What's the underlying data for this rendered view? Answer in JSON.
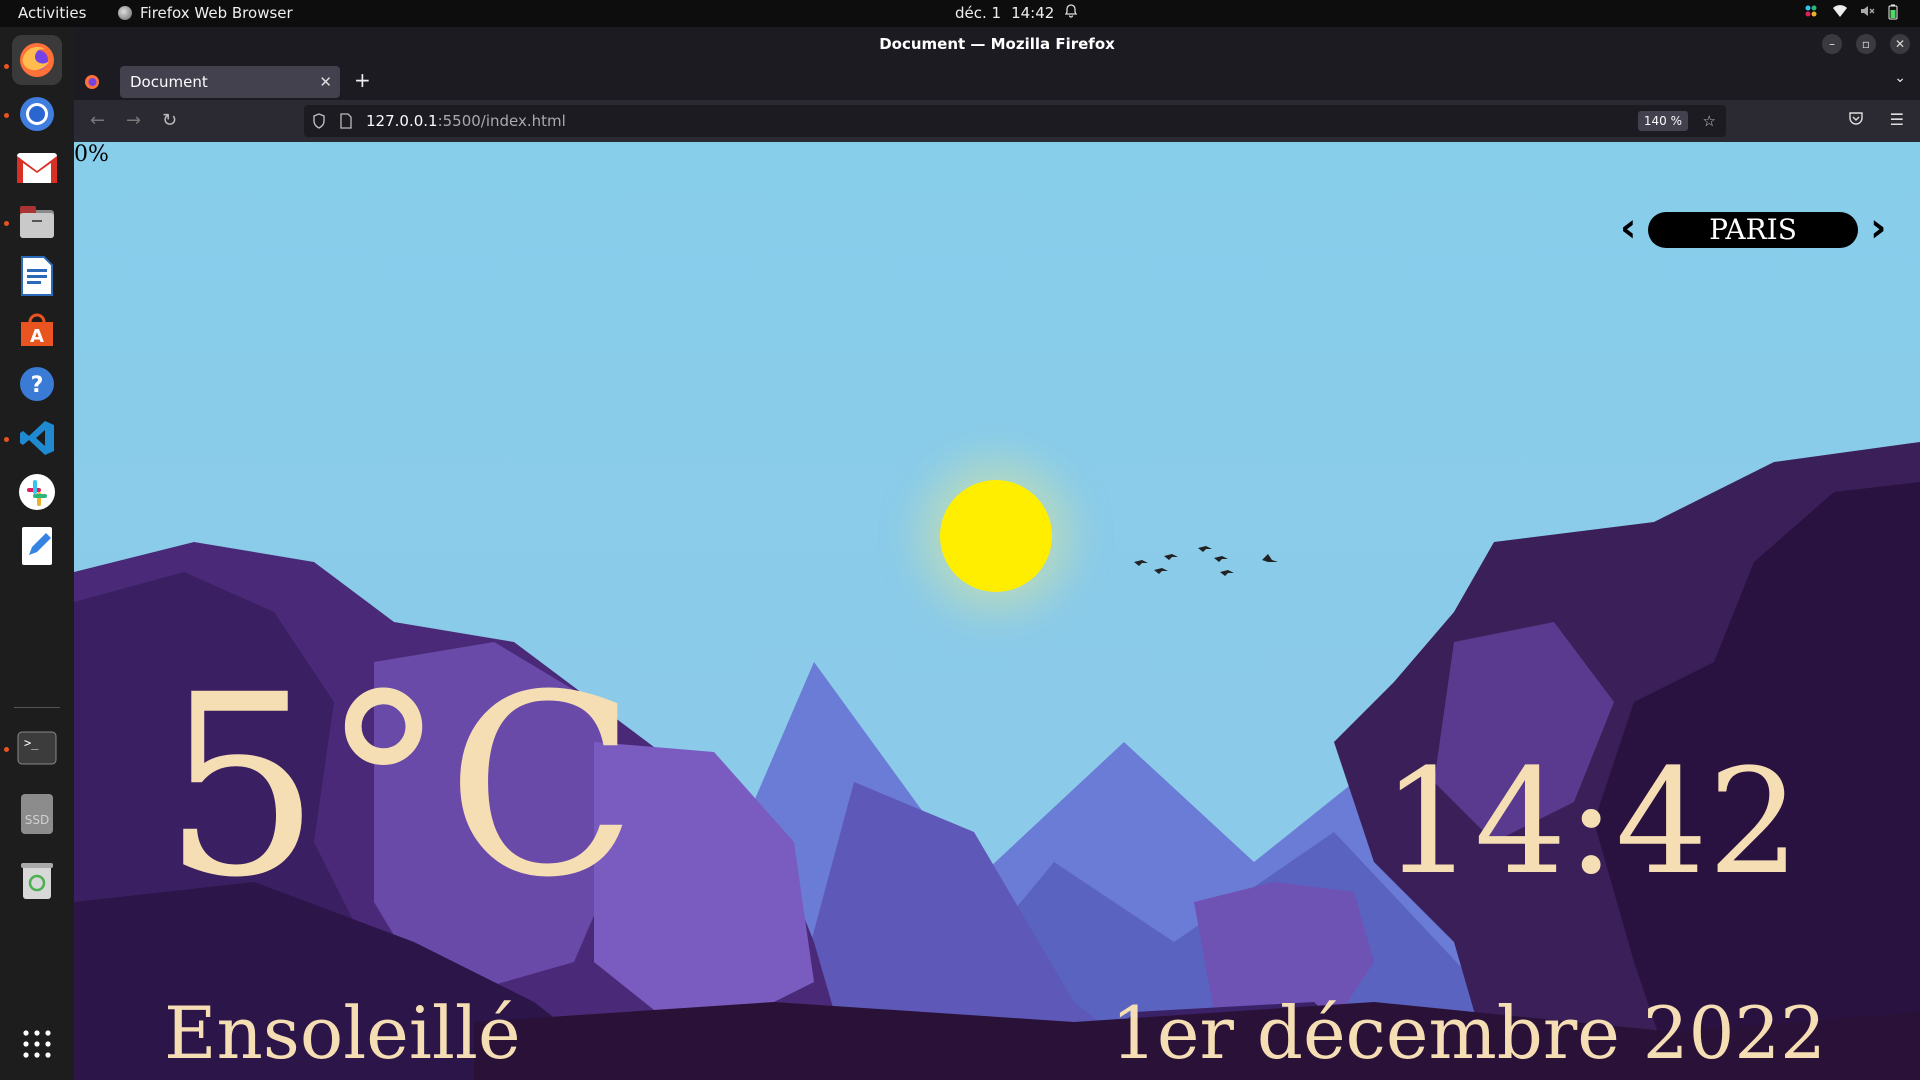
{
  "topbar": {
    "activities": "Activities",
    "app_name": "Firefox Web Browser",
    "date": "déc. 1",
    "time": "14:42"
  },
  "window": {
    "title": "Document — Mozilla Firefox"
  },
  "tabs": [
    {
      "label": "Document"
    }
  ],
  "urlbar": {
    "host": "127.0.0.1",
    "path": ":5500/index.html",
    "zoom": "140 %"
  },
  "page": {
    "progress": "0%",
    "city": "PARIS",
    "temperature": "5°C",
    "time": "14:42",
    "condition": "Ensoleillé",
    "date": "1er décembre 2022"
  }
}
